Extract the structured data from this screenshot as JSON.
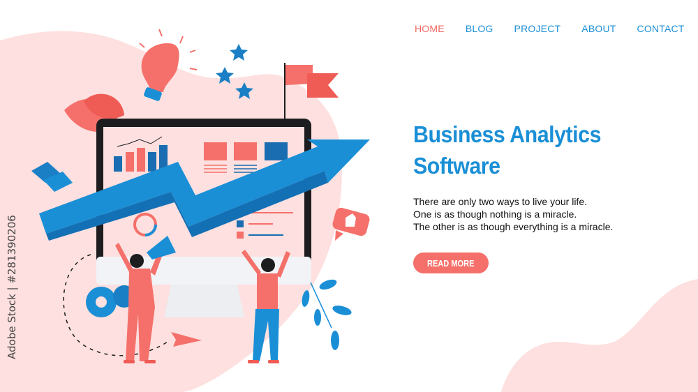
{
  "nav": {
    "items": [
      {
        "label": "HOME",
        "active": true
      },
      {
        "label": "BLOG",
        "active": false
      },
      {
        "label": "PROJECT",
        "active": false
      },
      {
        "label": "ABOUT",
        "active": false
      },
      {
        "label": "CONTACT",
        "active": false
      }
    ]
  },
  "hero": {
    "title_line1": "Business Analytics",
    "title_line2": "Software",
    "text_lines": [
      "There are only two ways to live your life.",
      "One is as though nothing is a miracle.",
      "The other is as though everything is a miracle."
    ],
    "button_label": "READ MORE"
  },
  "watermark": {
    "stock_id": "Adobe Stock | #281390206"
  },
  "colors": {
    "accent_blue": "#1a8fd6",
    "accent_coral": "#f5706a",
    "background_pink": "#fde0df",
    "monitor_dark": "#1d1d1f"
  }
}
